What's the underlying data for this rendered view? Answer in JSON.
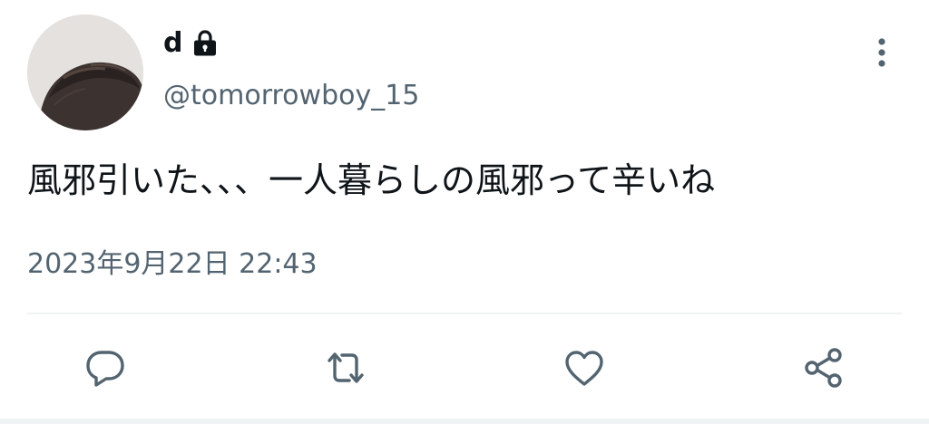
{
  "user": {
    "display_name": "d",
    "handle": "@tomorrowboy_15",
    "protected_icon": "lock-icon"
  },
  "tweet": {
    "text": "風邪引いた、、、一人暮らしの風邪って辛いね",
    "timestamp": "2023年9月22日 22:43"
  },
  "actions": [
    {
      "name": "reply",
      "icon": "speech-bubble-icon"
    },
    {
      "name": "retweet",
      "icon": "retweet-arrows-icon"
    },
    {
      "name": "like",
      "icon": "heart-icon"
    },
    {
      "name": "share",
      "icon": "share-icon"
    }
  ],
  "menu": {
    "icon": "vertical-ellipsis-icon"
  },
  "colors": {
    "text_primary": "#0f1419",
    "text_secondary": "#536471",
    "divider": "#eff3f4"
  }
}
